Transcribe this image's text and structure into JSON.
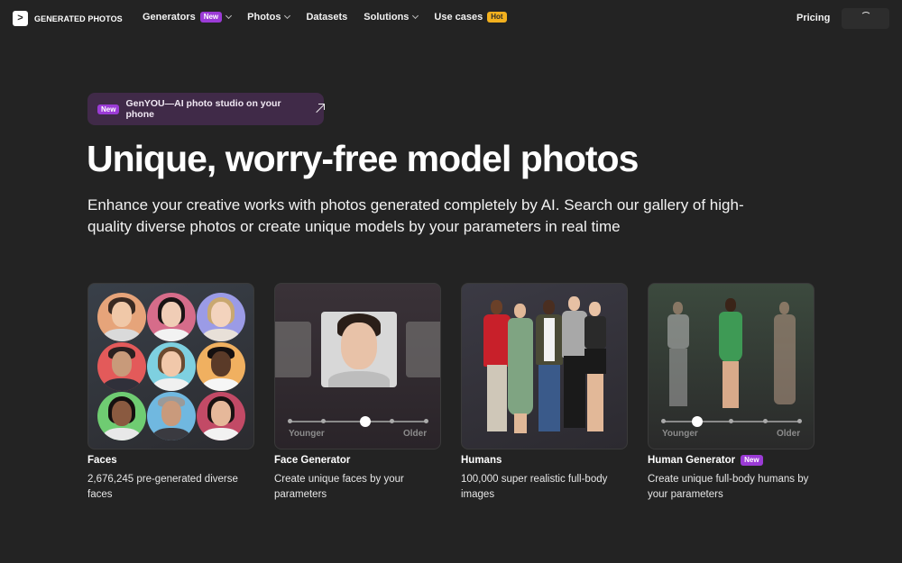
{
  "nav": {
    "logo_mark": ">",
    "logo_text": "GENERATED PHOTOS",
    "items": [
      {
        "label": "Generators",
        "badge": "New",
        "dropdown": true
      },
      {
        "label": "Photos",
        "dropdown": true
      },
      {
        "label": "Datasets",
        "dropdown": false
      },
      {
        "label": "Solutions",
        "dropdown": true
      },
      {
        "label": "Use cases",
        "badge": "Hot",
        "dropdown": false
      }
    ],
    "pricing": "Pricing"
  },
  "hero": {
    "promo_badge": "New",
    "promo_text": "GenYOU—AI photo studio on your phone",
    "headline": "Unique, worry-free model photos",
    "subhead": "Enhance your creative works with photos generated completely by AI. Search our gallery of high-quality diverse photos or create unique models by your parameters in real time"
  },
  "cards": [
    {
      "title": "Faces",
      "desc": "2,676,245 pre-generated diverse faces"
    },
    {
      "title": "Face Generator",
      "desc": "Create unique faces by your parameters",
      "slider_left": "Younger",
      "slider_right": "Older",
      "slider_level": 0.55
    },
    {
      "title": "Humans",
      "desc": "100,000 super realistic full-body images"
    },
    {
      "title": "Human Generator",
      "badge": "New",
      "desc": "Create unique full-body humans by your parameters",
      "slider_left": "Younger",
      "slider_right": "Older",
      "slider_level": 0.25
    }
  ],
  "colors": {
    "background": "#232323",
    "badge_new": "#9b3bd6",
    "badge_hot": "#f2b01e",
    "promo_bg": "#402a48"
  },
  "icons": {
    "chevron": "chevron-down-icon",
    "arrow": "arrow-up-right-icon",
    "loading": "spinner-icon"
  }
}
